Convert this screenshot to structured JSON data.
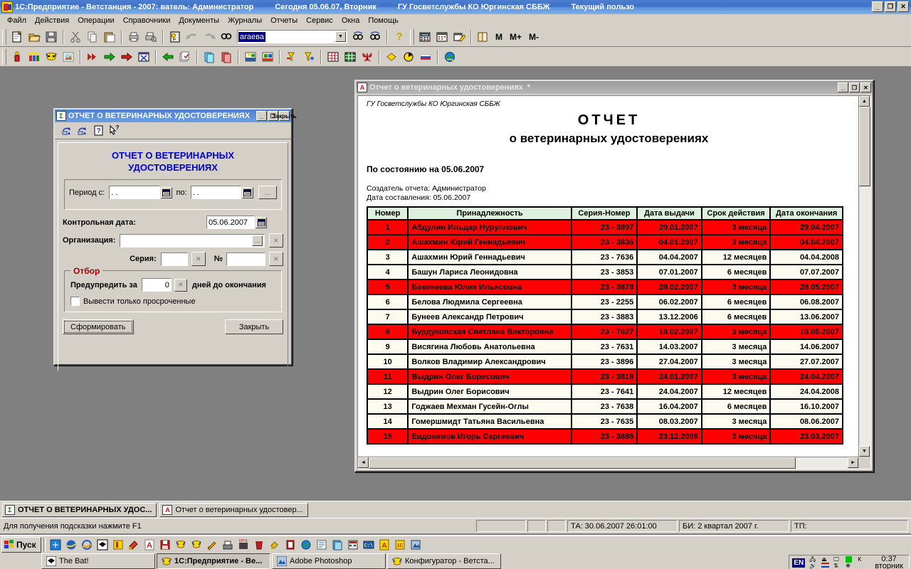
{
  "titlebar": {
    "app_title": "1С:Предприятие - Ветстанция - 2007: ватель: Администратор",
    "date_segment": "Сегодня 05.06.07, Вторник",
    "org_segment": "ГУ Госветслужбы КО Юргинская СББЖ",
    "user_segment": "Текущий пользо",
    "min_label": "_",
    "restore_label": "❐",
    "close_label": "✕"
  },
  "menu": {
    "items": [
      "Файл",
      "Действия",
      "Операции",
      "Справочники",
      "Документы",
      "Журналы",
      "Отчеты",
      "Сервис",
      "Окна",
      "Помощь"
    ]
  },
  "toolbar1": {
    "search_value": "агаева",
    "dropdown_arrow": "▼",
    "m_label": "M",
    "mplus_label": "M+",
    "mminus_label": "M-",
    "icons": [
      "new-document-icon",
      "open-folder-icon",
      "save-icon",
      "cut-icon",
      "copy-icon",
      "paste-icon",
      "print-icon",
      "print-preview-icon",
      "key-icon",
      "undo-icon",
      "redo-icon",
      "find-icon",
      "find-next-icon",
      "find-prev-icon",
      "help-question-icon",
      "calculator-icon",
      "calendar-icon",
      "wizard-icon",
      "book-icon"
    ]
  },
  "toolbar2": {
    "icons": [
      "person-icon",
      "group-people-icon",
      "mask-icon",
      "picture-icon",
      "fast-forward-icon",
      "green-arrow-icon",
      "red-arrow-icon",
      "hourglass-cancel-icon",
      "green-back-arrow-icon",
      "documents-check-icon",
      "copy-page-blue-icon",
      "copy-page-red-icon",
      "workplace-icon",
      "workshop-icon",
      "filter-minus-icon",
      "filter-plus-icon",
      "table-grid-icon",
      "spreadsheet-icon",
      "butterfly-icon",
      "diamond-icon",
      "pie-icon",
      "flag-russia-icon",
      "globe-icon"
    ]
  },
  "dialog": {
    "title": "ОТЧЕТ О ВЕТЕРИНАРНЫХ УДОСТОВЕРЕНИЯХ",
    "icon": "Σ",
    "min_label": "_",
    "restore_label": "❐",
    "close_label": "Закрыть",
    "toolbar_icons": [
      "print-report-icon",
      "print-report-copy-icon",
      "help-icon",
      "context-help-icon"
    ],
    "heading_line1": "ОТЧЕТ О ВЕТЕРИНАРНЫХ",
    "heading_line2": "УДОСТОВЕРЕНИЯХ",
    "period_label": "Период с:",
    "period_from_value": "  .  .",
    "period_to_label": "по:",
    "period_to_value": "  .  .",
    "period_more_label": "...",
    "control_date_label": "Контрольная дата:",
    "control_date_value": "05.06.2007",
    "organization_label": "Организация:",
    "organization_value": "",
    "organization_pick_label": "...",
    "organization_clear_label": "✕",
    "series_label": "Серия:",
    "series_value": "",
    "series_clear_label": "✕",
    "number_label": "№",
    "number_value": "",
    "number_clear_label": "✕",
    "filter_legend": "Отбор",
    "warn_prefix": "Предупредить за",
    "warn_days_value": "0",
    "warn_clear_label": "✕",
    "warn_suffix": "дней до окончания",
    "overdue_checkbox_label": "Вывести только просроченные",
    "generate_label": "Сформировать"
  },
  "report_window": {
    "title": "Отчет о ветеринарных удостоверениях",
    "modified_marker": "*",
    "icon": "A",
    "min_label": "_",
    "restore_label": "❐",
    "close_label": "✕",
    "org_line": "ГУ Госветслужбы КО Юргинская СББЖ",
    "title_line1": "ОТЧЕТ",
    "title_line2": "о ветеринарных удостоверениях",
    "state_line": "По состоянию на 05.06.2007",
    "author_line": "Создатель отчета: Администратор",
    "compiled_line": "Дата составления: 05.06.2007",
    "scroll_up": "▲",
    "scroll_down": "▼",
    "scroll_left": "◄",
    "scroll_right": "►"
  },
  "chart_data": {
    "type": "table",
    "title": "ОТЧЕТ о ветеринарных удостоверениях",
    "columns": [
      "Номер",
      "Принадлежность",
      "Серия-Номер",
      "Дата выдачи",
      "Срок действия",
      "Дата окончания"
    ],
    "rows": [
      {
        "num": "1",
        "owner": "Абдулин Ильдар Нуруллович",
        "series": "23 - 3897",
        "issued": "29.01.2007",
        "term": "3 месяца",
        "expires": "29.04.2007",
        "alert": true
      },
      {
        "num": "2",
        "owner": "Ашахмин Юрий Геннадьевич",
        "series": "23 - 3836",
        "issued": "04.01.2007",
        "term": "3 месяца",
        "expires": "04.04.2007",
        "alert": true
      },
      {
        "num": "3",
        "owner": "Ашахмин Юрий Геннадьевич",
        "series": "23 - 7636",
        "issued": "04.04.2007",
        "term": "12 месяцев",
        "expires": "04.04.2008",
        "alert": false
      },
      {
        "num": "4",
        "owner": "Башун Лариса Леонидовна",
        "series": "23 - 3853",
        "issued": "07.01.2007",
        "term": "6 месяцев",
        "expires": "07.07.2007",
        "alert": false
      },
      {
        "num": "5",
        "owner": "Бекенеева Юлия Ильясовна",
        "series": "23 - 3878",
        "issued": "28.02.2007",
        "term": "3 месяца",
        "expires": "28.05.2007",
        "alert": true
      },
      {
        "num": "6",
        "owner": "Белова Людмила Сергеевна",
        "series": "23 - 2255",
        "issued": "06.02.2007",
        "term": "6 месяцев",
        "expires": "06.08.2007",
        "alert": false
      },
      {
        "num": "7",
        "owner": "Бунеев Александр Петрович",
        "series": "23 - 3883",
        "issued": "13.12.2006",
        "term": "6 месяцев",
        "expires": "13.06.2007",
        "alert": false
      },
      {
        "num": "8",
        "owner": "Бурдуковская Светлана Викторовна",
        "series": "23 - 7627",
        "issued": "18.02.2007",
        "term": "3 месяца",
        "expires": "18.05.2007",
        "alert": true
      },
      {
        "num": "9",
        "owner": "Висягина Любовь Анатольевна",
        "series": "23 - 7631",
        "issued": "14.03.2007",
        "term": "3 месяца",
        "expires": "14.06.2007",
        "alert": false
      },
      {
        "num": "10",
        "owner": "Волков Владимир Александрович",
        "series": "23 - 3896",
        "issued": "27.04.2007",
        "term": "3 месяца",
        "expires": "27.07.2007",
        "alert": false
      },
      {
        "num": "11",
        "owner": "Выдрин Олег Борисович",
        "series": "23 - 3818",
        "issued": "24.01.2007",
        "term": "3 месяца",
        "expires": "24.04.2007",
        "alert": true
      },
      {
        "num": "12",
        "owner": "Выдрин Олег Борисович",
        "series": "23 - 7641",
        "issued": "24.04.2007",
        "term": "12 месяцев",
        "expires": "24.04.2008",
        "alert": false
      },
      {
        "num": "13",
        "owner": "Годжаев Мехман Гусейн-Оглы",
        "series": "23 - 7638",
        "issued": "16.04.2007",
        "term": "6 месяцев",
        "expires": "16.10.2007",
        "alert": false
      },
      {
        "num": "14",
        "owner": "Гомершмидт Татьяна Васильевна",
        "series": "23 - 7635",
        "issued": "08.03.2007",
        "term": "3 месяца",
        "expires": "08.06.2007",
        "alert": false
      },
      {
        "num": "15",
        "owner": "Евдокимов Игорь Сергеевич",
        "series": "23 - 3886",
        "issued": "23.12.2006",
        "term": "3 месяца",
        "expires": "23.03.2007",
        "alert": true
      }
    ],
    "alert_color": "#fe0000",
    "header_color": "#ddf0dd",
    "cell_color": "#fdfbf0"
  },
  "window_list": {
    "items": [
      {
        "label": "ОТЧЕТ О ВЕТЕРИНАРНЫХ УДОС...",
        "icon": "Σ",
        "active": true
      },
      {
        "label": "Отчет о ветеринарных удостовер...",
        "icon": "A",
        "active": false
      }
    ]
  },
  "statusbar": {
    "hint": "Для получения подсказки нажмите F1",
    "ta": "ТА: 30.06.2007  26:01:00",
    "bi": "БИ: 2 квартал 2007 г.",
    "tp": "ТП:"
  },
  "taskbar": {
    "start_label": "Пуск",
    "quicklaunch_icons": [
      "ie-channel-icon",
      "netscape-icon",
      "internet-explorer-icon",
      "thebat-icon",
      "1c-yellow-icon",
      "paint-icon",
      "acrobat-icon",
      "save-disk-icon",
      "1c-v7-icon",
      "1c-v7-alt-icon",
      "pencil-icon",
      "scanner-icon",
      "krga-icon",
      "recycle-bin-icon",
      "printer-icon",
      "red-book-icon",
      "world-icon",
      "note-icon",
      "documents-icon",
      "calc-red-icon",
      "cmd-icon",
      "acrobat-yellow-icon",
      "1c-v8-icon",
      "photoshop-icon"
    ],
    "tasks": [
      {
        "label": "The Bat!",
        "icon": "thebat-icon",
        "active": false
      },
      {
        "label": "1С:Предприятие - Ве...",
        "icon": "1c-icon",
        "active": true
      },
      {
        "label": "Adobe Photoshop",
        "icon": "photoshop-icon",
        "active": false
      },
      {
        "label": "Конфигуратор - Ветста...",
        "icon": "1c-config-icon",
        "active": false
      }
    ],
    "lang": "EN",
    "tray_icons": [
      "network-icon",
      "safely-remove-icon",
      "display-icon",
      "green-square-icon",
      "k-icon",
      "volume-icon",
      "us-flag-icon",
      "updown-arrows-icon",
      "bug-icon"
    ],
    "clock_time": "0:37",
    "clock_day": "вторник"
  }
}
